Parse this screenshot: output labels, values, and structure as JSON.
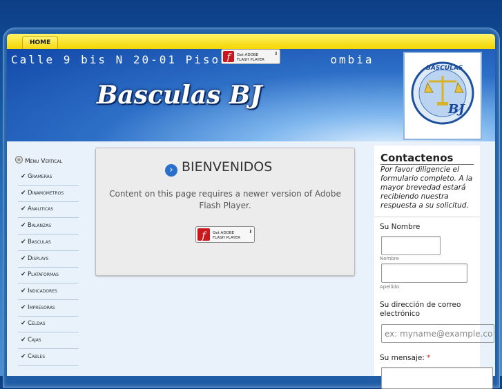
{
  "nav": {
    "home_label": "HOME"
  },
  "header": {
    "address": "Calle 9 bis N 20-01 Piso 3 Bo",
    "address_tail": "ombia",
    "site_title": "Basculas BJ",
    "logo_text_top": "BASCULAS",
    "logo_text_bottom": "BJ"
  },
  "flash_badge": {
    "line1": "Get ADOBE",
    "line2": "FLASH PLAYER"
  },
  "sidebar": {
    "title": "Menu Vertical",
    "items": [
      {
        "label": "Grameras"
      },
      {
        "label": "Dinamometros"
      },
      {
        "label": "Analiticas"
      },
      {
        "label": "Balanzas"
      },
      {
        "label": "Basculas"
      },
      {
        "label": "Displays"
      },
      {
        "label": "Plataformas"
      },
      {
        "label": "Indicadores"
      },
      {
        "label": "Impresoras"
      },
      {
        "label": "Celdas"
      },
      {
        "label": "Cajas"
      },
      {
        "label": "Cables"
      }
    ]
  },
  "main": {
    "heading": "BIENVENIDOS",
    "flash_message": "Content on this page requires a newer version of Adobe Flash Player."
  },
  "contact": {
    "title": "Contactenos",
    "description": "Por favor diligencie el formulario completo. A la mayor brevedad estará recibiendo nuestra respuesta a su solicitud.",
    "name_label": "Su Nombre",
    "first_sub": "Nombre",
    "last_sub": "Apellido",
    "email_label": "Su dirección de correo electrónico",
    "email_placeholder": "ex: myname@example.co",
    "message_label": "Su mensaje:",
    "required_mark": "*"
  },
  "colors": {
    "accent_yellow": "#f6d409",
    "header_blue": "#1f5ea6",
    "arrow_blue": "#2a6fcc",
    "required_red": "#d8261f"
  }
}
